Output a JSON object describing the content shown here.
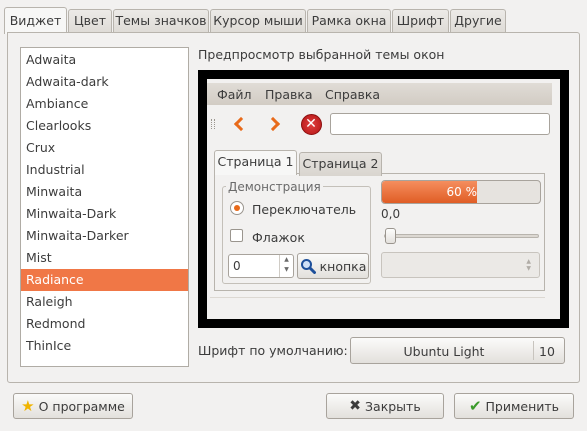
{
  "tabs": [
    {
      "label": "Виджет",
      "active": true
    },
    {
      "label": "Цвет",
      "active": false
    },
    {
      "label": "Темы значков",
      "active": false
    },
    {
      "label": "Курсор мыши",
      "active": false
    },
    {
      "label": "Рамка окна",
      "active": false
    },
    {
      "label": "Шрифт",
      "active": false
    },
    {
      "label": "Другие",
      "active": false
    }
  ],
  "themes": [
    "Adwaita",
    "Adwaita-dark",
    "Ambiance",
    "Clearlooks",
    "Crux",
    "Industrial",
    "Minwaita",
    "Minwaita-Dark",
    "Minwaita-Darker",
    "Mist",
    "Radiance",
    "Raleigh",
    "Redmond",
    "ThinIce"
  ],
  "selected_theme": "Radiance",
  "preview": {
    "label": "Предпросмотр выбранной темы окон",
    "menu": [
      "Файл",
      "Правка",
      "Справка"
    ],
    "toolbar_icons": [
      "back-icon",
      "forward-icon",
      "stop-icon"
    ],
    "tabs": [
      "Страница 1",
      "Страница 2"
    ],
    "frame_label": "Демонстрация",
    "radio_label": "Переключатель",
    "checkbox_label": "Флажок",
    "spin_value": "0",
    "button_label": "кнопка",
    "button_icon": "search-icon",
    "progress_text": "60 %",
    "progress_fraction": 0.6,
    "scale_value": "0,0",
    "accent_color": "#f07746"
  },
  "font": {
    "label": "Шрифт по умолчанию:",
    "name": "Ubuntu Light",
    "size": "10"
  },
  "buttons": {
    "about": "О программе",
    "close": "Закрыть",
    "apply": "Применить"
  }
}
